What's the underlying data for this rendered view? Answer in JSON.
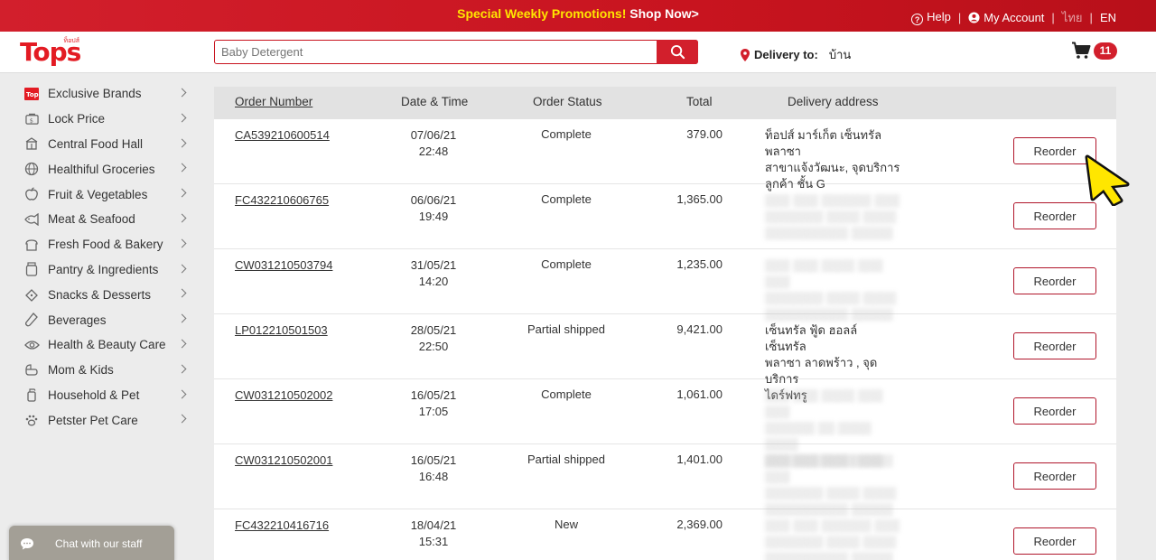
{
  "topbar": {
    "promo_yellow": "Special Weekly Promotions!",
    "promo_white": "Shop Now>",
    "help": "Help",
    "account": "My Account",
    "lang_thai": "ไทย",
    "lang_en": "EN",
    "sep": "|"
  },
  "header": {
    "logo_text": "Tops",
    "logo_tiny": "ท็อปส์",
    "search_placeholder": "Baby Detergent",
    "delivery_label": "Delivery to:",
    "delivery_location": "บ้าน",
    "cart_count": "11"
  },
  "sidebar": {
    "items": [
      {
        "label": "Exclusive Brands",
        "icon": "tops-brand-icon"
      },
      {
        "label": "Lock Price",
        "icon": "lock-icon"
      },
      {
        "label": "Central Food Hall",
        "icon": "food-hall-icon"
      },
      {
        "label": "Healthiful Groceries",
        "icon": "globe-icon"
      },
      {
        "label": "Fruit & Vegetables",
        "icon": "apple-icon"
      },
      {
        "label": "Meat & Seafood",
        "icon": "fish-icon"
      },
      {
        "label": "Fresh Food & Bakery",
        "icon": "bread-icon"
      },
      {
        "label": "Pantry & Ingredients",
        "icon": "jar-icon"
      },
      {
        "label": "Snacks & Desserts",
        "icon": "cookie-icon"
      },
      {
        "label": "Beverages",
        "icon": "bottle-icon"
      },
      {
        "label": "Health & Beauty Care",
        "icon": "eye-icon"
      },
      {
        "label": "Mom & Kids",
        "icon": "baby-icon"
      },
      {
        "label": "Household & Pet",
        "icon": "spray-icon"
      },
      {
        "label": "Petster Pet Care",
        "icon": "paw-icon"
      }
    ]
  },
  "orders": {
    "columns": {
      "number": "Order Number",
      "date": "Date & Time",
      "status": "Order Status",
      "total": "Total",
      "address": "Delivery address"
    },
    "reorder_label": "Reorder",
    "rows": [
      {
        "number": "CA539210600514",
        "date": "07/06/21",
        "time": "22:48",
        "status": "Complete",
        "total": "379.00",
        "addr": [
          "ท็อปส์ มาร์เก็ต เซ็นทรัลพลาซา",
          "สาขาแจ้งวัฒนะ, จุดบริการ",
          "ลูกค้า ชั้น G"
        ],
        "blur": false
      },
      {
        "number": "FC432210606765",
        "date": "06/06/21",
        "time": "19:49",
        "status": "Complete",
        "total": "1,365.00",
        "addr": [
          "",
          "",
          ""
        ],
        "blur": true
      },
      {
        "number": "CW031210503794",
        "date": "31/05/21",
        "time": "14:20",
        "status": "Complete",
        "total": "1,235.00",
        "addr": [
          "",
          "",
          ""
        ],
        "blur": true
      },
      {
        "number": "LP012210501503",
        "date": "28/05/21",
        "time": "22:50",
        "status": "Partial shipped",
        "total": "9,421.00",
        "addr": [
          "เซ็นทรัล ฟู้ด ฮอลล์ เซ็นทรัล",
          "พลาซา ลาดพร้าว , จุดบริการ",
          "ไดร์ฟทรู"
        ],
        "blur": false
      },
      {
        "number": "CW031210502002",
        "date": "16/05/21",
        "time": "17:05",
        "status": "Complete",
        "total": "1,061.00",
        "addr": [
          "",
          "",
          ""
        ],
        "blur": true
      },
      {
        "number": "CW031210502001",
        "date": "16/05/21",
        "time": "16:48",
        "status": "Partial shipped",
        "total": "1,401.00",
        "addr": [
          "",
          "",
          ""
        ],
        "blur": true
      },
      {
        "number": "FC432210416716",
        "date": "18/04/21",
        "time": "15:31",
        "status": "New",
        "total": "2,369.00",
        "addr": [
          "",
          "",
          ""
        ],
        "blur": true
      }
    ]
  },
  "chat": {
    "label": "Chat with our staff"
  },
  "colors": {
    "brand_red": "#d21f2c",
    "promo_yellow": "#ffe600",
    "cursor_yellow": "#ffe600"
  }
}
